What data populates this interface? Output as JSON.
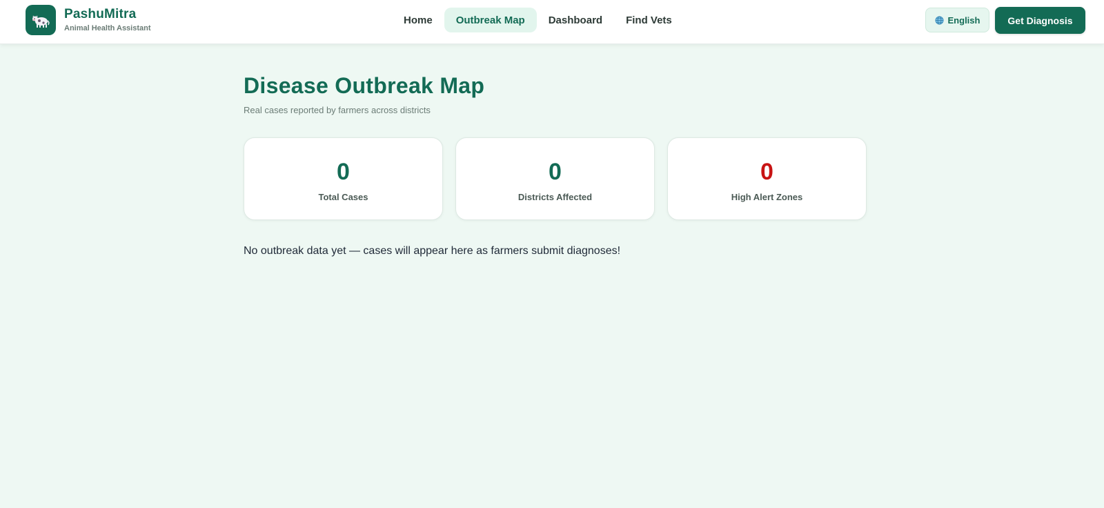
{
  "brand": {
    "name": "PashuMitra",
    "tagline": "Animal Health Assistant",
    "logo_icon": "cow-icon"
  },
  "nav": {
    "items": [
      {
        "label": "Home",
        "active": false
      },
      {
        "label": "Outbreak Map",
        "active": true
      },
      {
        "label": "Dashboard",
        "active": false
      },
      {
        "label": "Find Vets",
        "active": false
      }
    ]
  },
  "header_actions": {
    "language_label": "English",
    "language_icon": "globe-icon",
    "diagnosis_label": "Get Diagnosis"
  },
  "page": {
    "title": "Disease Outbreak Map",
    "subtitle": "Real cases reported by farmers across districts"
  },
  "stats": [
    {
      "value": "0",
      "label": "Total Cases",
      "color": "#136b55"
    },
    {
      "value": "0",
      "label": "Districts Affected",
      "color": "#136b55"
    },
    {
      "value": "0",
      "label": "High Alert Zones",
      "color": "#c81414"
    }
  ],
  "empty_message": "No outbreak data yet — cases will appear here as farmers submit diagnoses!",
  "colors": {
    "brand": "#136b55",
    "background": "#eef8f3",
    "alert": "#c81414"
  }
}
